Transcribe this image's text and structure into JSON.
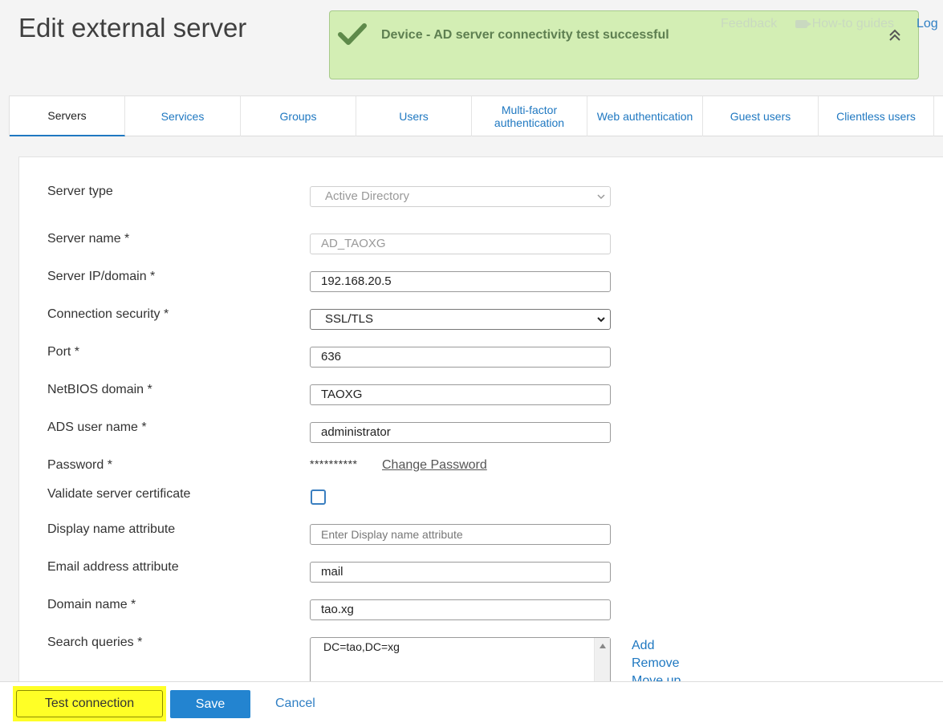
{
  "page": {
    "title": "Edit external server"
  },
  "top_links": {
    "feedback": "Feedback",
    "guides": "How-to guides",
    "logout": "Log",
    "guides_icon": "video-camera-icon"
  },
  "notice": {
    "message": "Device - AD server connectivity test successful",
    "icon": "check-icon",
    "collapse_icon": "chevron-double-up-icon",
    "color": "#cdeca8"
  },
  "tabs": [
    {
      "label": "Servers",
      "active": true
    },
    {
      "label": "Services"
    },
    {
      "label": "Groups"
    },
    {
      "label": "Users"
    },
    {
      "label": "Multi-factor authentication"
    },
    {
      "label": "Web authentication"
    },
    {
      "label": "Guest users"
    },
    {
      "label": "Clientless users"
    }
  ],
  "form": {
    "server_type": {
      "label": "Server type",
      "value": "Active Directory"
    },
    "server_name": {
      "label": "Server name *",
      "value": "AD_TAOXG"
    },
    "server_ip": {
      "label": "Server IP/domain *",
      "value": "192.168.20.5"
    },
    "connection_security": {
      "label": "Connection security *",
      "value": "SSL/TLS"
    },
    "port": {
      "label": "Port *",
      "value": "636"
    },
    "netbios": {
      "label": "NetBIOS domain *",
      "value": "TAOXG"
    },
    "ads_user": {
      "label": "ADS user name *",
      "value": "administrator"
    },
    "password": {
      "label": "Password *",
      "mask": "**********",
      "change_link": "Change Password"
    },
    "validate_cert": {
      "label": "Validate server certificate",
      "checked": false
    },
    "display_name_attr": {
      "label": "Display name attribute",
      "placeholder": "Enter Display name attribute"
    },
    "email_attr": {
      "label": "Email address attribute",
      "value": "mail"
    },
    "domain_name": {
      "label": "Domain name *",
      "value": "tao.xg"
    },
    "search_queries": {
      "label": "Search queries *",
      "value": "DC=tao,DC=xg",
      "actions": [
        "Add",
        "Remove",
        "Move up"
      ]
    }
  },
  "footer": {
    "test_label": "Test connection",
    "save_label": "Save",
    "cancel_label": "Cancel"
  },
  "colors": {
    "accent": "#2384d0",
    "highlight": "#ffff26",
    "link": "#1f78c1"
  }
}
